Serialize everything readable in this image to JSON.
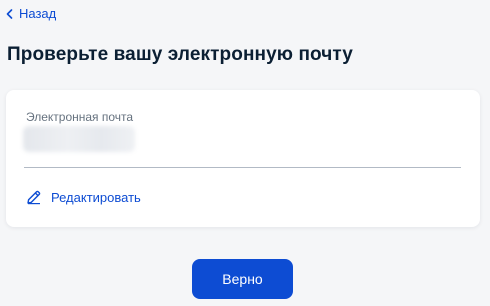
{
  "nav": {
    "back_label": "Назад",
    "back_icon": "chevron-left-icon"
  },
  "page": {
    "title": "Проверьте вашу электронную почту"
  },
  "email_card": {
    "field_label": "Электронная почта",
    "edit_label": "Редактировать",
    "edit_icon": "pencil-icon"
  },
  "actions": {
    "confirm_label": "Верно"
  },
  "colors": {
    "accent": "#0d4cd3",
    "background": "#f5f6f8",
    "card": "#ffffff",
    "text": "#0b1f33",
    "muted_text": "#66727f"
  }
}
